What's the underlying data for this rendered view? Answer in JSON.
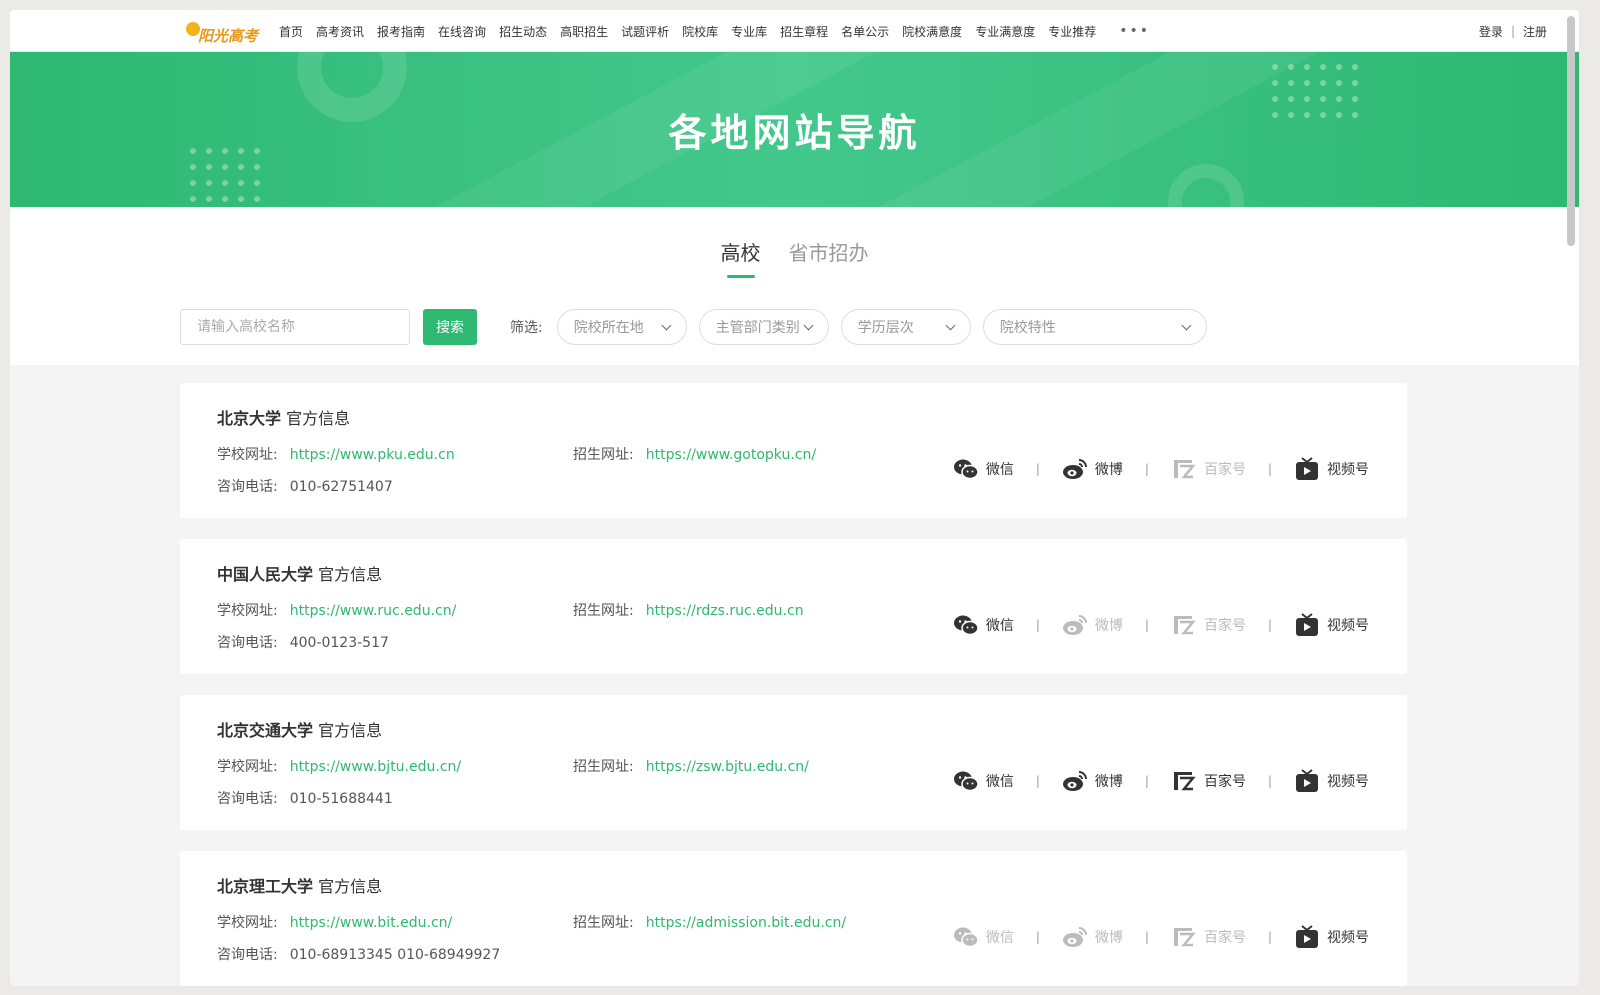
{
  "logo": {
    "text": "阳光高考"
  },
  "nav": {
    "items": [
      "首页",
      "高考资讯",
      "报考指南",
      "在线咨询",
      "招生动态",
      "高职招生",
      "试题评析",
      "院校库",
      "专业库",
      "招生章程",
      "名单公示",
      "院校满意度",
      "专业满意度",
      "专业推荐"
    ],
    "more": "•••",
    "login": "登录",
    "sep": "|",
    "register": "注册"
  },
  "banner": {
    "title": "各地网站导航"
  },
  "tabs": [
    {
      "label": "高校",
      "active": true
    },
    {
      "label": "省市招办",
      "active": false
    }
  ],
  "filters": {
    "search_placeholder": "请输入高校名称",
    "search_button": "搜索",
    "label": "筛选:",
    "selects": [
      "院校所在地",
      "主管部门类别",
      "学历层次",
      "院校特性"
    ]
  },
  "labels": {
    "official_info": "官方信息",
    "school_site": "学校网址:",
    "admission_site": "招生网址:",
    "phone": "咨询电话:",
    "wechat": "微信",
    "weibo": "微博",
    "baijia": "百家号",
    "video": "视频号"
  },
  "schools": [
    {
      "name": "北京大学",
      "site": "https://www.pku.edu.cn",
      "admission": "https://www.gotopku.cn/",
      "phone": "010-62751407",
      "wechat": true,
      "weibo": true,
      "baijia": false,
      "video": true
    },
    {
      "name": "中国人民大学",
      "site": "https://www.ruc.edu.cn/",
      "admission": "https://rdzs.ruc.edu.cn",
      "phone": "400-0123-517",
      "wechat": true,
      "weibo": false,
      "baijia": false,
      "video": true
    },
    {
      "name": "北京交通大学",
      "site": "https://www.bjtu.edu.cn/",
      "admission": "https://zsw.bjtu.edu.cn/",
      "phone": "010-51688441",
      "wechat": true,
      "weibo": true,
      "baijia": true,
      "video": true
    },
    {
      "name": "北京理工大学",
      "site": "https://www.bit.edu.cn/",
      "admission": "https://admission.bit.edu.cn/",
      "phone": "010-68913345 010-68949927",
      "wechat": false,
      "weibo": false,
      "baijia": false,
      "video": true
    }
  ],
  "colors": {
    "accent": "#2eb872",
    "disabled": "#bbbbbb"
  }
}
